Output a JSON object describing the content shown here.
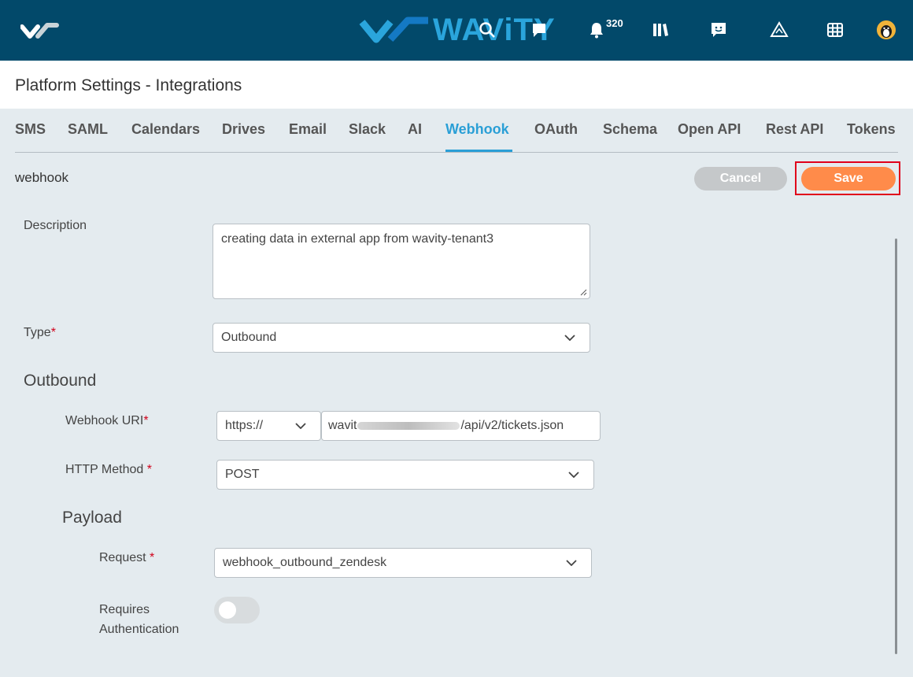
{
  "header": {
    "brand": "WAViTY",
    "notification_count": "320",
    "icons": [
      "wavity-mark-icon",
      "search-icon",
      "chat-bubble-icon",
      "bell-icon",
      "library-icon",
      "smiley-chat-icon",
      "workflow-triangle-icon",
      "grid-icon",
      "user-avatar"
    ]
  },
  "page": {
    "title": "Platform Settings - Integrations"
  },
  "tabs": [
    {
      "label": "SMS"
    },
    {
      "label": "SAML"
    },
    {
      "label": "Calendars"
    },
    {
      "label": "Drives"
    },
    {
      "label": "Email"
    },
    {
      "label": "Slack"
    },
    {
      "label": "AI"
    },
    {
      "label": "Webhook",
      "active": true
    },
    {
      "label": "OAuth"
    },
    {
      "label": "Schema"
    },
    {
      "label": "Open API"
    },
    {
      "label": "Rest API"
    },
    {
      "label": "Tokens"
    }
  ],
  "section": {
    "name": "webhook",
    "cancel_label": "Cancel",
    "save_label": "Save"
  },
  "form": {
    "description_label": "Description",
    "description_value": "creating data in external app from wavity-tenant3",
    "type_label": "Type",
    "type_value": "Outbound",
    "outbound_heading": "Outbound",
    "uri_label": "Webhook URI",
    "uri_scheme": "https://",
    "uri_prefix": "wavit",
    "uri_suffix": "/api/v2/tickets.json",
    "method_label": "HTTP Method",
    "method_value": "POST",
    "payload_heading": "Payload",
    "request_label": "Request",
    "request_value": "webhook_outbound_zendesk",
    "auth_label_line1": "Requires",
    "auth_label_line2": "Authentication",
    "auth_enabled": false,
    "required_mark": "*"
  },
  "colors": {
    "topbar": "#02496a",
    "accent": "#2a9fd6",
    "save": "#ff8b4a",
    "cancel": "#c5c8ca",
    "highlight": "#e0001b"
  }
}
